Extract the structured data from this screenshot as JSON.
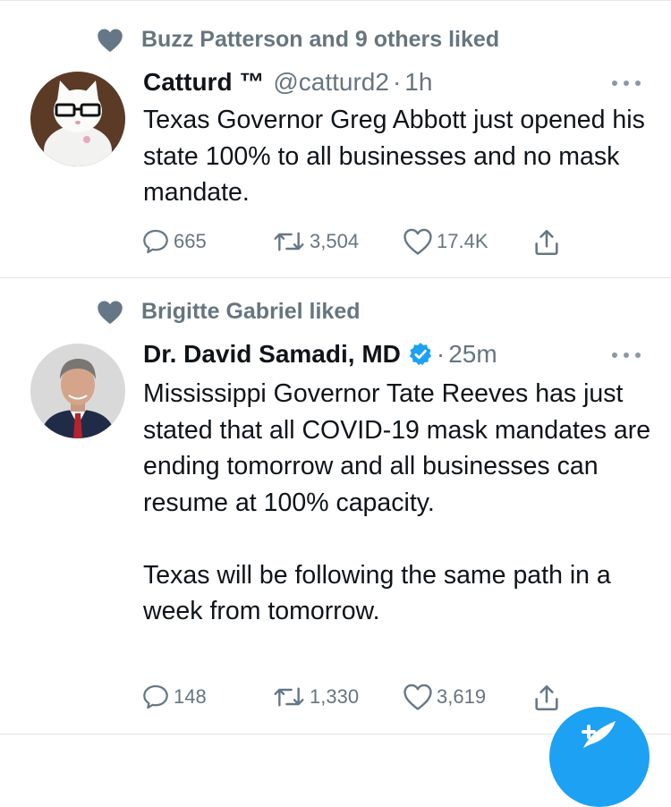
{
  "tweets": [
    {
      "social_context": "Buzz Patterson and 9 others liked",
      "name": "Catturd ™",
      "handle": "@catturd2",
      "separator": "·",
      "time": "1h",
      "verified": false,
      "text": "Texas Governor Greg Abbott just opened his state 100% to all businesses and no mask mandate.",
      "replies": "665",
      "retweets": "3,504",
      "likes": "17.4K"
    },
    {
      "social_context": "Brigitte Gabriel liked",
      "name": "Dr. David Samadi, MD",
      "handle": "",
      "separator": "·",
      "time": "25m",
      "verified": true,
      "text": "Mississippi Governor Tate Reeves has just stated that all COVID-19 mask mandates are ending tomorrow and all businesses can resume at 100% capacity.\n\nTexas will be following the same path in a week from tomorrow.",
      "replies": "148",
      "retweets": "1,330",
      "likes": "3,619"
    }
  ],
  "colors": {
    "text": "#0f1419",
    "secondary": "#66757f",
    "accent": "#1da1f2",
    "divider": "#dfe3e6"
  },
  "icons": {
    "social": "heart-filled-icon",
    "reply": "reply-icon",
    "retweet": "retweet-icon",
    "like": "heart-outline-icon",
    "share": "share-icon",
    "more": "more-icon",
    "verified": "verified-badge-icon",
    "compose": "compose-tweet-icon"
  }
}
